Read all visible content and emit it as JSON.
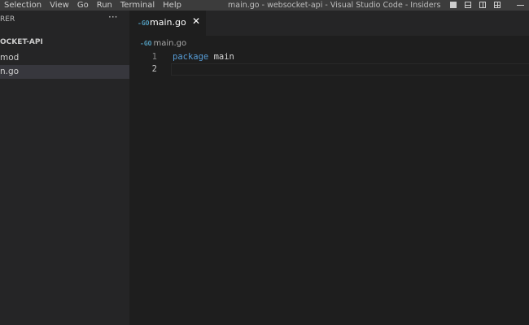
{
  "menu": [
    "Selection",
    "View",
    "Go",
    "Run",
    "Terminal",
    "Help"
  ],
  "window_title": "main.go - websocket-api - Visual Studio Code - Insiders",
  "sidebar": {
    "header": "RER",
    "more": "···",
    "folder": "OCKET-API",
    "items": [
      {
        "label": "mod"
      },
      {
        "label": "n.go",
        "selected": true
      }
    ]
  },
  "tab": {
    "icon": "-GO",
    "name": "main.go",
    "close": "✕"
  },
  "breadcrumb": {
    "icon": "-GO",
    "label": "main.go"
  },
  "code": {
    "lines": [
      {
        "num": "1",
        "keyword": "package",
        "rest": " main"
      },
      {
        "num": "2",
        "keyword": "",
        "rest": ""
      }
    ]
  },
  "colors": {
    "keyword": "#569cd6",
    "go_icon": "#519aba",
    "selected_item": "#37373d"
  }
}
